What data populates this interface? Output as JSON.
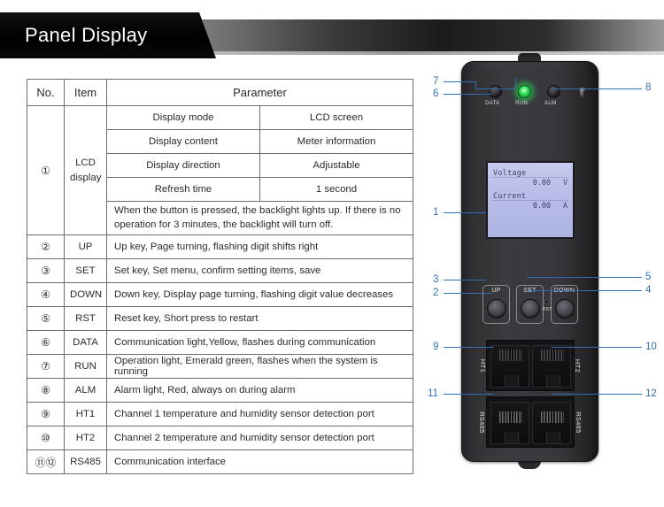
{
  "header": {
    "title": "Panel Display"
  },
  "table": {
    "columns": {
      "no": "No.",
      "item": "Item",
      "parameter": "Parameter"
    },
    "lcd_group": {
      "no": "①",
      "item_line1": "LCD",
      "item_line2": "display",
      "rows": [
        {
          "sub": "Display mode",
          "value": "LCD screen"
        },
        {
          "sub": "Display content",
          "value": "Meter information"
        },
        {
          "sub": "Display direction",
          "value": "Adjustable"
        },
        {
          "sub": "Refresh time",
          "value": "1 second"
        }
      ],
      "note": "When the button is pressed, the backlight lights up. If there is no operation for 3 minutes, the backlight will turn off."
    },
    "rows": [
      {
        "no": "②",
        "item": "UP",
        "desc": "Up key, Page turning, flashing digit shifts right"
      },
      {
        "no": "③",
        "item": "SET",
        "desc": "Set key, Set menu, confirm setting items, save"
      },
      {
        "no": "④",
        "item": "DOWN",
        "desc": "Down key, Display page turning, flashing digit value decreases"
      },
      {
        "no": "⑤",
        "item": "RST",
        "desc": "Reset key, Short press to restart"
      },
      {
        "no": "⑥",
        "item": "DATA",
        "desc": "Communication light,Yellow, flashes during communication"
      },
      {
        "no": "⑦",
        "item": "RUN",
        "desc": "Operation light, Emerald green, flashes when the system is running"
      },
      {
        "no": "⑧",
        "item": "ALM",
        "desc": "Alarm light, Red, always on during alarm"
      },
      {
        "no": "⑨",
        "item": "HT1",
        "desc": "Channel 1 temperature and humidity sensor detection port"
      },
      {
        "no": "⑩",
        "item": "HT2",
        "desc": "Channel 2 temperature and humidity sensor detection port"
      },
      {
        "no": "⑪⑫",
        "item": "RS485",
        "desc": "Communication interface"
      }
    ]
  },
  "device": {
    "leds": [
      {
        "label": "DATA",
        "state": "off"
      },
      {
        "label": "RUN",
        "state": "on"
      },
      {
        "label": "ALM",
        "state": "off"
      }
    ],
    "lcd": {
      "line1_label": "Voltage",
      "line1_value": "0.00",
      "line1_unit": "V",
      "line2_label": "Current",
      "line2_value": "0.00",
      "line2_unit": "A"
    },
    "buttons": [
      {
        "label": "UP"
      },
      {
        "label": "SET"
      },
      {
        "label": "DOWN"
      }
    ],
    "reset_label": "RST",
    "ports": {
      "ht1": "HT1",
      "ht2": "HT2",
      "rs485_left": "RS485",
      "rs485_right": "RS485"
    }
  },
  "callouts": {
    "left": [
      "7",
      "6",
      "1",
      "3",
      "2",
      "9",
      "11"
    ],
    "right": [
      "8",
      "5",
      "4",
      "10",
      "12"
    ]
  },
  "colors": {
    "callout": "#2f6fb5",
    "run_led": "#2ae156",
    "lcd_background": "#b9bee8",
    "banner": "#000000"
  }
}
